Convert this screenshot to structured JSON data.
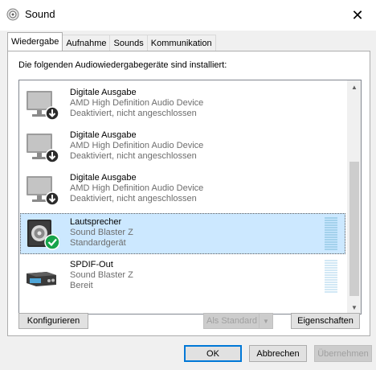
{
  "window": {
    "title": "Sound",
    "close_icon": "close-icon"
  },
  "tabs": [
    {
      "label": "Wiedergabe",
      "active": true
    },
    {
      "label": "Aufnahme",
      "active": false
    },
    {
      "label": "Sounds",
      "active": false
    },
    {
      "label": "Kommunikation",
      "active": false
    }
  ],
  "panel": {
    "instruction": "Die folgenden Audiowiedergabegeräte sind installiert:"
  },
  "devices": [
    {
      "name": "Digitale Ausgabe",
      "driver": "AMD High Definition Audio Device",
      "status": "Deaktiviert, nicht angeschlossen",
      "icon": "monitor-disabled-icon",
      "selected": false
    },
    {
      "name": "Digitale Ausgabe",
      "driver": "AMD High Definition Audio Device",
      "status": "Deaktiviert, nicht angeschlossen",
      "icon": "monitor-disabled-icon",
      "selected": false
    },
    {
      "name": "Digitale Ausgabe",
      "driver": "AMD High Definition Audio Device",
      "status": "Deaktiviert, nicht angeschlossen",
      "icon": "monitor-disabled-icon",
      "selected": false
    },
    {
      "name": "Lautsprecher",
      "driver": "Sound Blaster Z",
      "status": "Standardgerät",
      "icon": "speaker-default-icon",
      "selected": true
    },
    {
      "name": "SPDIF-Out",
      "driver": "Sound Blaster Z",
      "status": "Bereit",
      "icon": "spdif-device-icon",
      "selected": false
    }
  ],
  "panel_buttons": {
    "configure": "Konfigurieren",
    "set_default": "Als Standard",
    "properties": "Eigenschaften"
  },
  "dialog_buttons": {
    "ok": "OK",
    "cancel": "Abbrechen",
    "apply": "Übernehmen"
  },
  "colors": {
    "selection": "#cce8ff",
    "accent": "#0078d7",
    "check": "#16a34a"
  }
}
